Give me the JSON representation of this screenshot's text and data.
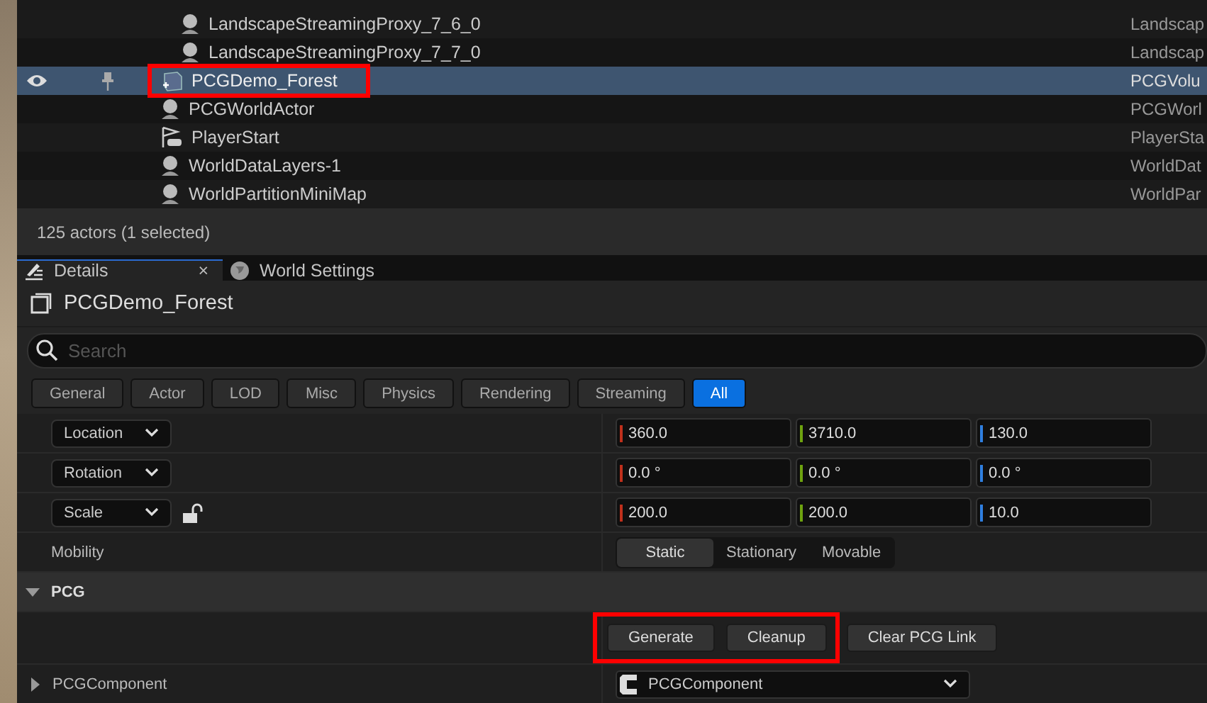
{
  "outliner": {
    "rows": [
      {
        "children": [
          {
            "name": "LandscapeStreamingProxy_7_6_0",
            "type": "Landscap",
            "kind": "actor",
            "selected": false,
            "highlighted": false
          },
          {
            "name": "LandscapeStreamingProxy_7_7_0",
            "type": "Landscap",
            "kind": "actor",
            "selected": false,
            "highlighted": false
          }
        ]
      },
      {
        "name": "PCGDemo_Forest",
        "type": "PCGVolu",
        "kind": "volume",
        "selected": true,
        "highlighted": true
      },
      {
        "name": "PCGWorldActor",
        "type": "PCGWorl",
        "kind": "actor",
        "selected": false,
        "highlighted": false
      },
      {
        "name": "PlayerStart",
        "type": "PlayerSta",
        "kind": "player",
        "selected": false,
        "highlighted": false
      },
      {
        "name": "WorldDataLayers-1",
        "type": "WorldDat",
        "kind": "actor",
        "selected": false,
        "highlighted": false
      },
      {
        "name": "WorldPartitionMiniMap",
        "type": "WorldPar",
        "kind": "actor",
        "selected": false,
        "highlighted": false
      }
    ],
    "status": "125 actors (1 selected)"
  },
  "tabs": [
    {
      "label": "Details",
      "kind": "details",
      "selected": true,
      "close": "×"
    },
    {
      "label": "World Settings",
      "kind": "world",
      "selected": false
    }
  ],
  "details": {
    "title": "PCGDemo_Forest",
    "search": {
      "placeholder": "Search"
    },
    "filters": [
      {
        "label": "General",
        "selected": false
      },
      {
        "label": "Actor",
        "selected": false
      },
      {
        "label": "LOD",
        "selected": false
      },
      {
        "label": "Misc",
        "selected": false
      },
      {
        "label": "Physics",
        "selected": false
      },
      {
        "label": "Rendering",
        "selected": false
      },
      {
        "label": "Streaming",
        "selected": false
      },
      {
        "label": "All",
        "selected": true
      }
    ],
    "transform": [
      {
        "label": "Location",
        "values": [
          "360.0",
          "3710.0",
          "130.0"
        ]
      },
      {
        "label": "Rotation",
        "values": [
          "0.0 °",
          "0.0 °",
          "0.0 °"
        ]
      },
      {
        "label": "Scale",
        "values": [
          "200.0",
          "200.0",
          "10.0"
        ],
        "locked": false
      }
    ],
    "mobility": {
      "label": "Mobility",
      "options": [
        {
          "label": "Static",
          "selected": true
        },
        {
          "label": "Stationary",
          "selected": false
        },
        {
          "label": "Movable",
          "selected": false
        }
      ]
    },
    "pcg": {
      "label": "PCG",
      "expanded": true,
      "buttons": [
        {
          "label": "Generate",
          "highlighted": true
        },
        {
          "label": "Cleanup",
          "highlighted": true
        },
        {
          "label": "Clear PCG Link",
          "highlighted": false
        }
      ]
    },
    "component": {
      "label": "PCGComponent",
      "expanded": false,
      "value": "PCGComponent"
    }
  }
}
